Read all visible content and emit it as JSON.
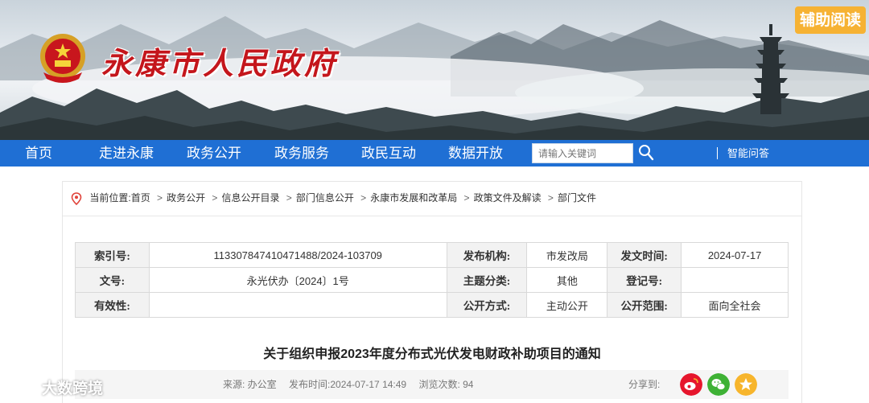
{
  "header": {
    "site_title": "永康市人民政府",
    "assist_button": "辅助阅读"
  },
  "nav": {
    "items": [
      "首页",
      "走进永康",
      "政务公开",
      "政务服务",
      "政民互动",
      "数据开放"
    ],
    "search_placeholder": "请输入关键词",
    "smart_qa": "智能问答"
  },
  "breadcrumb": {
    "prefix": "当前位置:",
    "items": [
      "首页",
      "政务公开",
      "信息公开目录",
      "部门信息公开",
      "永康市发展和改革局",
      "政策文件及解读",
      "部门文件"
    ],
    "separator": ">"
  },
  "meta": {
    "rows": [
      [
        {
          "label": "索引号:",
          "value": "113307847410471488/2024-103709"
        },
        {
          "label": "发布机构:",
          "value": "市发改局"
        },
        {
          "label": "发文时间:",
          "value": "2024-07-17"
        }
      ],
      [
        {
          "label": "文号:",
          "value": "永光伏办〔2024〕1号"
        },
        {
          "label": "主题分类:",
          "value": "其他"
        },
        {
          "label": "登记号:",
          "value": ""
        }
      ],
      [
        {
          "label": "有效性:",
          "value": ""
        },
        {
          "label": "公开方式:",
          "value": "主动公开"
        },
        {
          "label": "公开范围:",
          "value": "面向全社会"
        }
      ]
    ]
  },
  "article": {
    "title": "关于组织申报2023年度分布式光伏发电财政补助项目的通知",
    "source": "来源: 办公室",
    "publish_time": "发布时间:2024-07-17 14:49",
    "views": "浏览次数: 94",
    "share_label": "分享到:"
  },
  "watermark": {
    "text": "大数跨境"
  },
  "colors": {
    "nav_bg": "#1f6fd4",
    "title_red": "#c4161c",
    "assist_orange": "#f6b233",
    "weibo": "#e6162d",
    "wechat": "#3eb135",
    "qzone": "#f7b52c"
  },
  "icons": {
    "emblem": "national-emblem-icon",
    "search": "search-icon",
    "location": "location-pin-icon",
    "share": [
      "weibo-icon",
      "wechat-icon",
      "qzone-icon"
    ]
  }
}
